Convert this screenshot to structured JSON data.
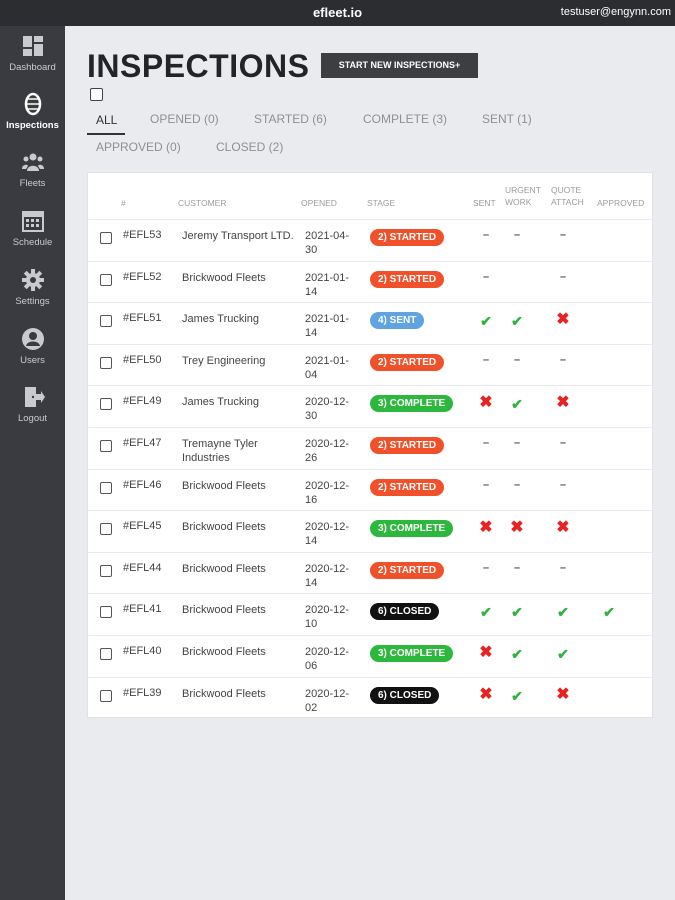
{
  "app": {
    "title": "efleet.io",
    "user_email": "testuser@engynn.com"
  },
  "sidebar": {
    "items": [
      {
        "label": "Dashboard",
        "icon": "dashboard-icon",
        "active": false
      },
      {
        "label": "Inspections",
        "icon": "tire-icon",
        "active": true
      },
      {
        "label": "Fleets",
        "icon": "people-icon",
        "active": false
      },
      {
        "label": "Schedule",
        "icon": "calendar-icon",
        "active": false
      },
      {
        "label": "Settings",
        "icon": "gear-icon",
        "active": false
      },
      {
        "label": "Users",
        "icon": "user-icon",
        "active": false
      },
      {
        "label": "Logout",
        "icon": "logout-icon",
        "active": false
      }
    ]
  },
  "page": {
    "title": "INSPECTIONS",
    "new_button": "START NEW INSPECTIONS+"
  },
  "tabs": [
    {
      "label": "ALL"
    },
    {
      "label": "OPENED (0)"
    },
    {
      "label": "STARTED (6)"
    },
    {
      "label": "COMPLETE (3)"
    },
    {
      "label": "SENT (1)"
    },
    {
      "label": "APPROVED (0)"
    },
    {
      "label": "CLOSED (2)"
    }
  ],
  "table": {
    "headers": {
      "num": "#",
      "customer": "CUSTOMER",
      "opened": "OPENED",
      "stage": "STAGE",
      "sent": "SENT",
      "urgent_1": "URGENT",
      "urgent_2": "WORK",
      "quote_1": "QUOTE",
      "quote_2": "ATTACH",
      "approved": "APPROVED"
    },
    "rows": [
      {
        "num": "#EFL53",
        "customer": "Jeremy Transport LTD.",
        "opened": "2021-04-30",
        "stage": "2) STARTED",
        "stage_type": "started",
        "sent": "dash",
        "urgent": "dash",
        "quote": "dash",
        "approved": ""
      },
      {
        "num": "#EFL52",
        "customer": "Brickwood Fleets",
        "opened": "2021-01-14",
        "stage": "2) STARTED",
        "stage_type": "started",
        "sent": "dash",
        "urgent": "",
        "quote": "dash",
        "approved": ""
      },
      {
        "num": "#EFL51",
        "customer": "James Trucking",
        "opened": "2021-01-14",
        "stage": "4) SENT",
        "stage_type": "sent",
        "sent": "check",
        "urgent": "check",
        "quote": "cross",
        "approved": ""
      },
      {
        "num": "#EFL50",
        "customer": "Trey Engineering",
        "opened": "2021-01-04",
        "stage": "2) STARTED",
        "stage_type": "started",
        "sent": "dash",
        "urgent": "dash",
        "quote": "dash",
        "approved": ""
      },
      {
        "num": "#EFL49",
        "customer": "James Trucking",
        "opened": "2020-12-30",
        "stage": "3) COMPLETE",
        "stage_type": "complete",
        "sent": "cross",
        "urgent": "check",
        "quote": "cross",
        "approved": ""
      },
      {
        "num": "#EFL47",
        "customer": "Tremayne Tyler Industries",
        "opened": "2020-12-26",
        "stage": "2) STARTED",
        "stage_type": "started",
        "sent": "dash",
        "urgent": "dash",
        "quote": "dash",
        "approved": ""
      },
      {
        "num": "#EFL46",
        "customer": "Brickwood Fleets",
        "opened": "2020-12-16",
        "stage": "2) STARTED",
        "stage_type": "started",
        "sent": "dash",
        "urgent": "dash",
        "quote": "dash",
        "approved": ""
      },
      {
        "num": "#EFL45",
        "customer": "Brickwood Fleets",
        "opened": "2020-12-14",
        "stage": "3) COMPLETE",
        "stage_type": "complete",
        "sent": "cross",
        "urgent": "cross",
        "quote": "cross",
        "approved": ""
      },
      {
        "num": "#EFL44",
        "customer": "Brickwood Fleets",
        "opened": "2020-12-14",
        "stage": "2) STARTED",
        "stage_type": "started",
        "sent": "dash",
        "urgent": "dash",
        "quote": "dash",
        "approved": ""
      },
      {
        "num": "#EFL41",
        "customer": "Brickwood Fleets",
        "opened": "2020-12-10",
        "stage": "6) CLOSED",
        "stage_type": "closed",
        "sent": "check",
        "urgent": "check",
        "quote": "check",
        "approved": "check"
      },
      {
        "num": "#EFL40",
        "customer": "Brickwood Fleets",
        "opened": "2020-12-06",
        "stage": "3) COMPLETE",
        "stage_type": "complete",
        "sent": "cross",
        "urgent": "check",
        "quote": "check",
        "approved": ""
      },
      {
        "num": "#EFL39",
        "customer": "Brickwood Fleets",
        "opened": "2020-12-02",
        "stage": "6) CLOSED",
        "stage_type": "closed",
        "sent": "cross",
        "urgent": "check",
        "quote": "cross",
        "approved": ""
      }
    ]
  },
  "colors": {
    "started": "#f0512a",
    "sent": "#5fa3e0",
    "complete": "#2cb83c",
    "closed": "#111111",
    "check": "#2fb23e",
    "cross": "#e82121"
  }
}
